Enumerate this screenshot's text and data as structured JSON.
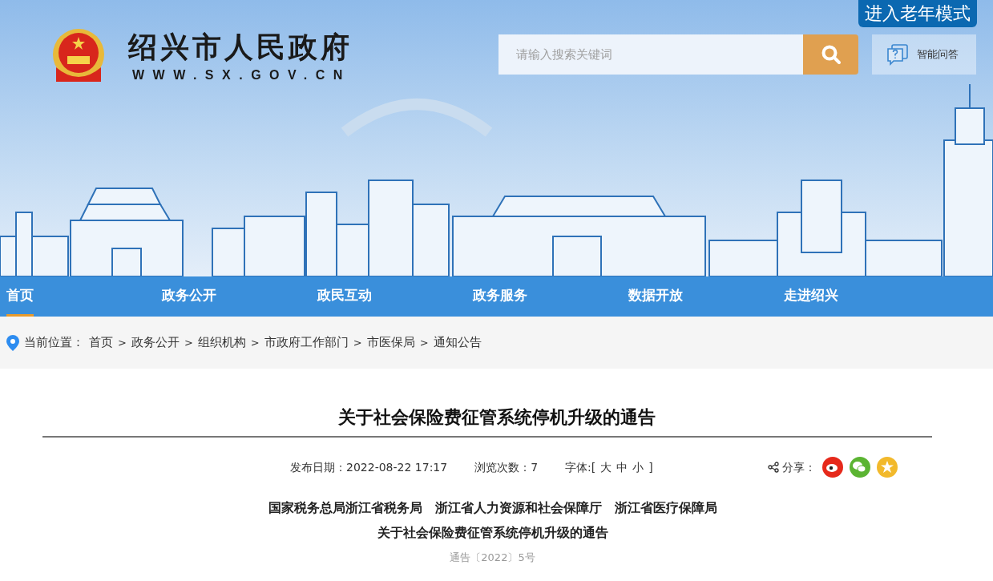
{
  "header": {
    "site_name": "绍兴市人民政府",
    "site_url": "WWW.SX.GOV.CN",
    "elder_mode_button": "进入老年模式",
    "search": {
      "placeholder": "请输入搜索关键词"
    },
    "qa_button": "智能问答"
  },
  "nav": [
    {
      "label": "首页",
      "selected": true
    },
    {
      "label": "政务公开",
      "selected": false
    },
    {
      "label": "政民互动",
      "selected": false
    },
    {
      "label": "政务服务",
      "selected": false
    },
    {
      "label": "数据开放",
      "selected": false
    },
    {
      "label": "走进绍兴",
      "selected": false
    }
  ],
  "breadcrumb": {
    "label": "当前位置：",
    "items": [
      {
        "kind": "link",
        "text": "首页"
      },
      {
        "kind": "separator",
        "text": ">"
      },
      {
        "kind": "link",
        "text": "政务公开"
      },
      {
        "kind": "separator",
        "text": ">"
      },
      {
        "kind": "link",
        "text": "组织机构"
      },
      {
        "kind": "separator",
        "text": ">"
      },
      {
        "kind": "link",
        "text": "市政府工作部门"
      },
      {
        "kind": "separator",
        "text": ">"
      },
      {
        "kind": "link",
        "text": "市医保局"
      },
      {
        "kind": "separator",
        "text": ">"
      },
      {
        "kind": "link",
        "text": "通知公告"
      }
    ]
  },
  "article": {
    "title": "关于社会保险费征管系统停机升级的通告",
    "meta": {
      "date": "发布日期：2022-08-22 17:17",
      "views": "浏览次数：7",
      "font_label": "字体:[",
      "font_sizes": [
        "大",
        "中",
        "小"
      ],
      "font_close": "]",
      "share_label": "分享：",
      "share": [
        {
          "kind": "weibo"
        },
        {
          "kind": "wechat"
        },
        {
          "kind": "favorite"
        }
      ]
    },
    "body": [
      {
        "kind": "heading",
        "text": "国家税务总局浙江省税务局　浙江省人力资源和社会保障厅　浙江省医疗保障局"
      },
      {
        "kind": "heading",
        "text": "关于社会保险费征管系统停机升级的通告"
      },
      {
        "kind": "docnum",
        "text": "通告〔2022〕5号"
      }
    ]
  }
}
